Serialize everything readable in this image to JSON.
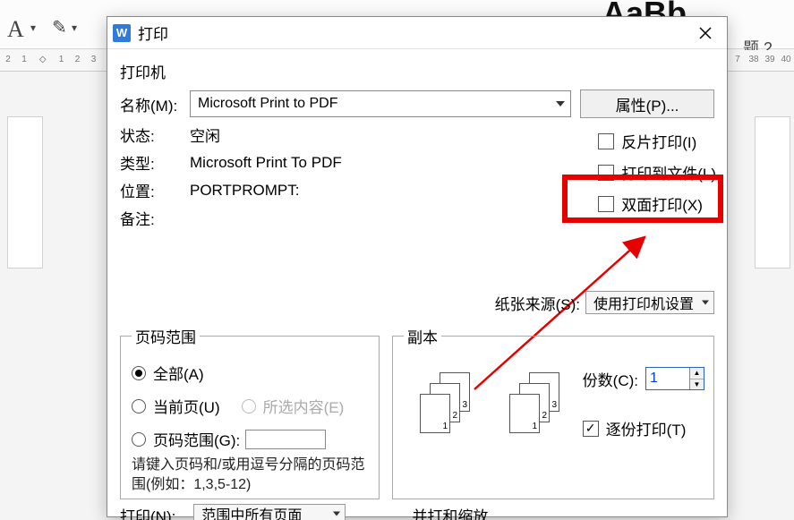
{
  "background": {
    "heading_style_preview": "AaBb",
    "heading_label": "题 2",
    "ruler_left": [
      "2",
      "1",
      "",
      "1",
      "2",
      "3"
    ],
    "ruler_right": [
      "7",
      "38",
      "39",
      "40"
    ]
  },
  "dialog": {
    "title": "打印",
    "printer_section": "打印机",
    "labels": {
      "name": "名称(M):",
      "status": "状态:",
      "type": "类型:",
      "location": "位置:",
      "comment": "备注:"
    },
    "values": {
      "name": "Microsoft Print to PDF",
      "status": "空闲",
      "type": "Microsoft Print To PDF",
      "location": "PORTPROMPT:",
      "comment": ""
    },
    "properties_button": "属性(P)...",
    "options": {
      "mirror": "反片打印(I)",
      "to_file": "打印到文件(L)",
      "duplex": "双面打印(X)"
    },
    "paper_source_label": "纸张来源(S):",
    "paper_source_value": "使用打印机设置",
    "range": {
      "legend": "页码范围",
      "all": "全部(A)",
      "current": "当前页(U)",
      "selection": "所选内容(E)",
      "pages": "页码范围(G):",
      "hint": "请键入页码和/或用逗号分隔的页码范围(例如：1,3,5-12)"
    },
    "copies": {
      "legend": "副本",
      "count_label": "份数(C):",
      "count_value": "1",
      "collate": "逐份打印(T)"
    },
    "bottom": {
      "print_what_label": "打印(N):",
      "print_what_value": "范围中所有页面",
      "zoom_label": "并打和缩放"
    }
  }
}
